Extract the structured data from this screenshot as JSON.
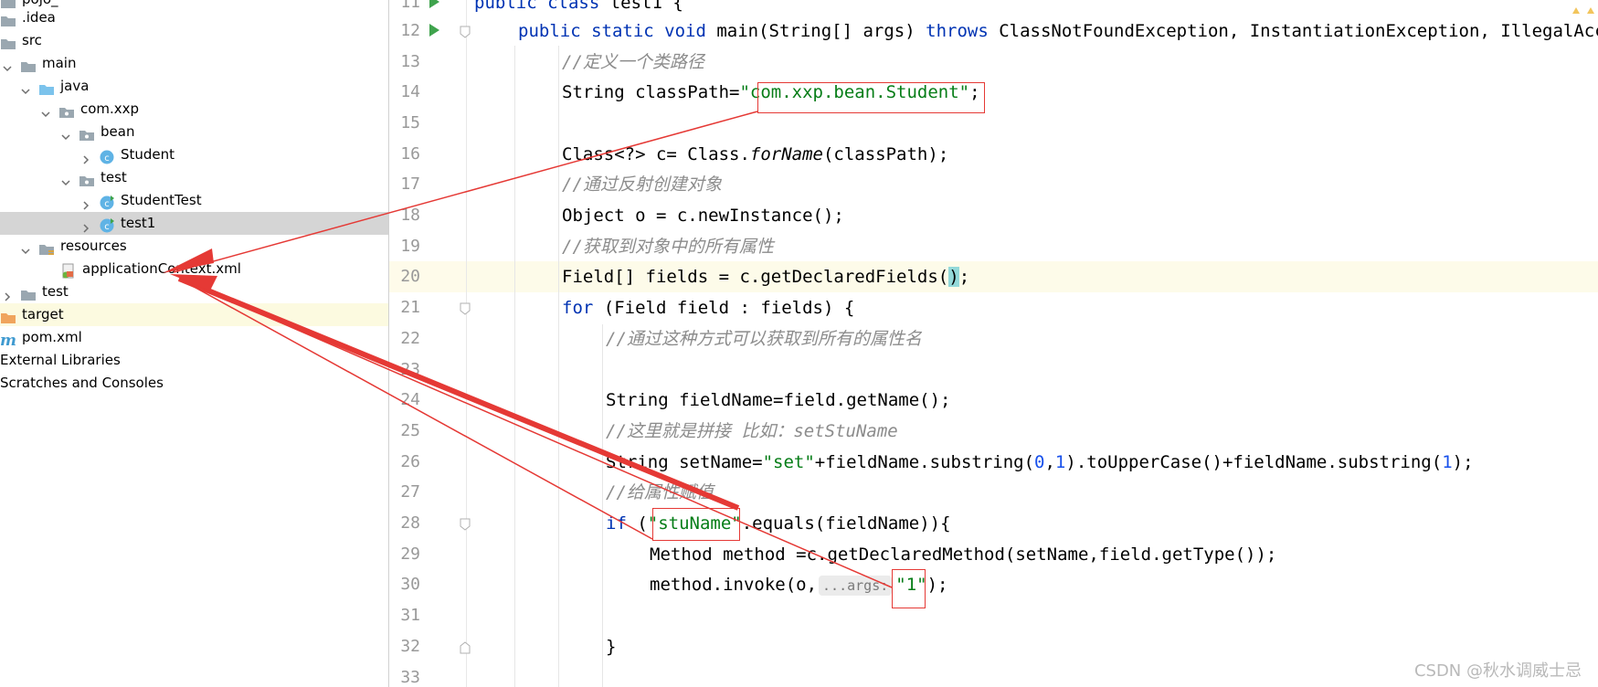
{
  "sidebar": {
    "items": [
      {
        "label": "pojo_",
        "icon": "folder",
        "expanded": null
      },
      {
        "label": ".idea",
        "icon": "folder",
        "expanded": null
      },
      {
        "label": "src",
        "icon": "folder",
        "expanded": null
      },
      {
        "label": "main",
        "icon": "folder",
        "expanded": true
      },
      {
        "label": "java",
        "icon": "source-folder",
        "expanded": true
      },
      {
        "label": "com.xxp",
        "icon": "package",
        "expanded": true
      },
      {
        "label": "bean",
        "icon": "package",
        "expanded": true
      },
      {
        "label": "Student",
        "icon": "class",
        "expanded": false
      },
      {
        "label": "test",
        "icon": "package",
        "expanded": true
      },
      {
        "label": "StudentTest",
        "icon": "class-runnable",
        "expanded": false
      },
      {
        "label": "test1",
        "icon": "class-runnable",
        "expanded": false
      },
      {
        "label": "resources",
        "icon": "resources-folder",
        "expanded": true
      },
      {
        "label": "applicationContext.xml",
        "icon": "xml",
        "expanded": null
      },
      {
        "label": "test",
        "icon": "folder",
        "expanded": false
      },
      {
        "label": "target",
        "icon": "excluded-folder",
        "expanded": null
      },
      {
        "label": "pom.xml",
        "icon": "maven",
        "expanded": null
      },
      {
        "label": "External Libraries",
        "icon": "none",
        "expanded": null
      },
      {
        "label": "Scratches and Consoles",
        "icon": "none",
        "expanded": null
      }
    ]
  },
  "editor": {
    "line_numbers": [
      "11",
      "12",
      "13",
      "14",
      "15",
      "16",
      "17",
      "18",
      "19",
      "20",
      "21",
      "22",
      "23",
      "24",
      "25",
      "26",
      "27",
      "28",
      "29",
      "30",
      "31",
      "32",
      "33"
    ],
    "code": {
      "l11_a": "public",
      "l11_b": " ",
      "l11_c": "class",
      "l11_d": " test1 {",
      "l12_a": "public static void",
      "l12_b": " main(String[] args) ",
      "l12_c": "throws",
      "l12_d": " ClassNotFoundException, InstantiationException, IllegalAccessException",
      "l13": "//定义一个类路径",
      "l14_a": "String classPath=",
      "l14_b": "\"com.xxp.bean.Student\"",
      "l14_c": ";",
      "l16_a": "Class<?> c= Class.",
      "l16_b": "forName",
      "l16_c": "(classPath);",
      "l17": "//通过反射创建对象",
      "l18": "Object o = c.newInstance();",
      "l19": "//获取到对象中的所有属性",
      "l20_a": "Field[] fields = c.getDeclaredFields(",
      "l20_b": ")",
      "l20_c": ";",
      "l21_a": "for",
      "l21_b": " (Field field : fields) {",
      "l22": "//通过这种方式可以获取到所有的属性名",
      "l24": "String fieldName=field.getName();",
      "l25": "//这里就是拼接 比如：setStuName",
      "l26_a": "String setName=",
      "l26_b": "\"set\"",
      "l26_c": "+fieldName.substring(",
      "l26_d": "0",
      "l26_e": ",",
      "l26_f": "1",
      "l26_g": ").toUpperCase()+fieldName.substring(",
      "l26_h": "1",
      "l26_i": ");",
      "l27": "//给属性赋值",
      "l28_a": "if",
      "l28_b": " (",
      "l28_c": "\"stuName\"",
      "l28_d": ".equals(fieldName)){",
      "l29": "Method method =c.getDeclaredMethod(setName,field.getType());",
      "l30_a": "method.invoke(o,",
      "l30_hint": "...args:",
      "l30_b": "\"1\"",
      "l30_c": ");",
      "l32": "}"
    }
  },
  "watermark": "CSDN @秋水调威士忌",
  "colors": {
    "annotation": "#e53935",
    "keyword": "#0033b3",
    "string": "#067d17",
    "number": "#1750eb",
    "comment": "#8c8c8c"
  }
}
